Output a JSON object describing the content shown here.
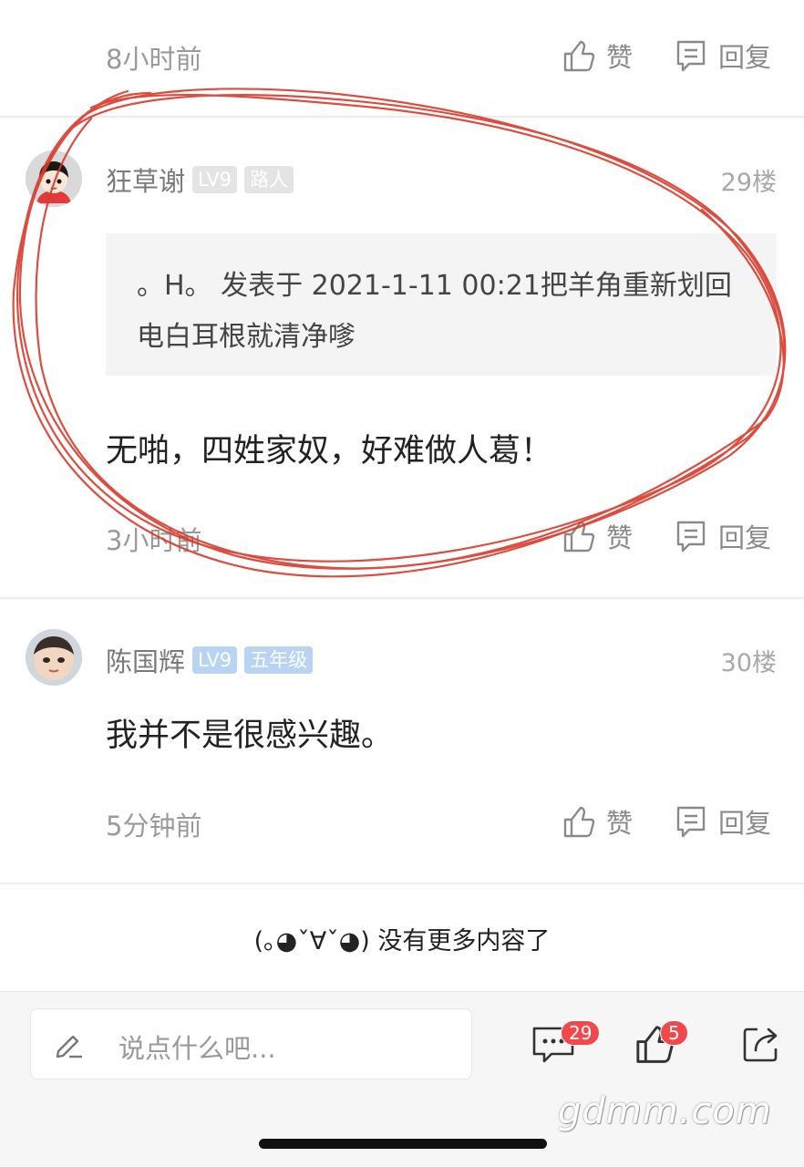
{
  "prev_comment": {
    "time": "8小时前",
    "like_label": "赞",
    "reply_label": "回复"
  },
  "comment_29": {
    "username": "狂草谢",
    "level": "LV9",
    "title": "路人",
    "floor": "29楼",
    "quote": "。H。 发表于 2021-1-11 00:21把羊角重新划回电白耳根就清净嗲",
    "content": "无啪，四姓家奴，好难做人葛！",
    "time": "3小时前",
    "like_label": "赞",
    "reply_label": "回复"
  },
  "comment_30": {
    "username": "陈国辉",
    "level": "LV9",
    "title": "五年级",
    "floor": "30楼",
    "content": "我并不是很感兴趣。",
    "time": "5分钟前",
    "like_label": "赞",
    "reply_label": "回复"
  },
  "footer": {
    "no_more": "(｡◕ˇ∀ˇ◕) 没有更多内容了"
  },
  "bottom_bar": {
    "placeholder": "说点什么吧...",
    "comment_count": "29",
    "like_count": "5"
  },
  "watermark": "gdmm.com",
  "colors": {
    "badge_red": "#f2484b",
    "annotation_red": "#d93a2b",
    "badge_blue": "#b9d3f5"
  }
}
